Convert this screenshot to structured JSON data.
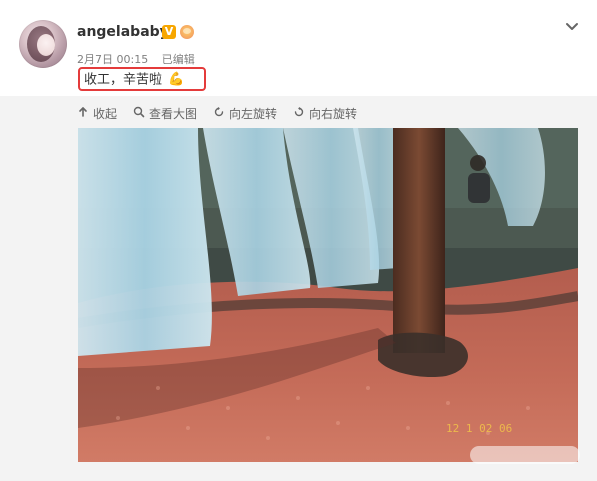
{
  "post": {
    "username": "angelababy",
    "verified_badge_label": "V",
    "meta": {
      "date_time": "2月7日 00:15",
      "edited_label": "已编辑"
    },
    "content_text": "收工，辛苦啦",
    "content_emoji": "💪"
  },
  "media_toolbar": {
    "collapse_label": "收起",
    "view_large_label": "查看大图",
    "rotate_left_label": "向左旋转",
    "rotate_right_label": "向右旋转"
  },
  "photo": {
    "timestamp_overlay": "12 1 02 06"
  },
  "icons": {
    "collapse": "arrow-up-icon",
    "view_large": "magnifier-icon",
    "rotate_left": "rotate-left-icon",
    "rotate_right": "rotate-right-icon",
    "post_menu": "chevron-down-icon",
    "verified": "verified-badge-icon",
    "emoji_badge": "emoji-badge-icon"
  },
  "colors": {
    "highlight_border": "#e43b3b",
    "verified_badge": "#f7a600",
    "meta_text": "#808080",
    "toolbar_text": "#666666"
  }
}
